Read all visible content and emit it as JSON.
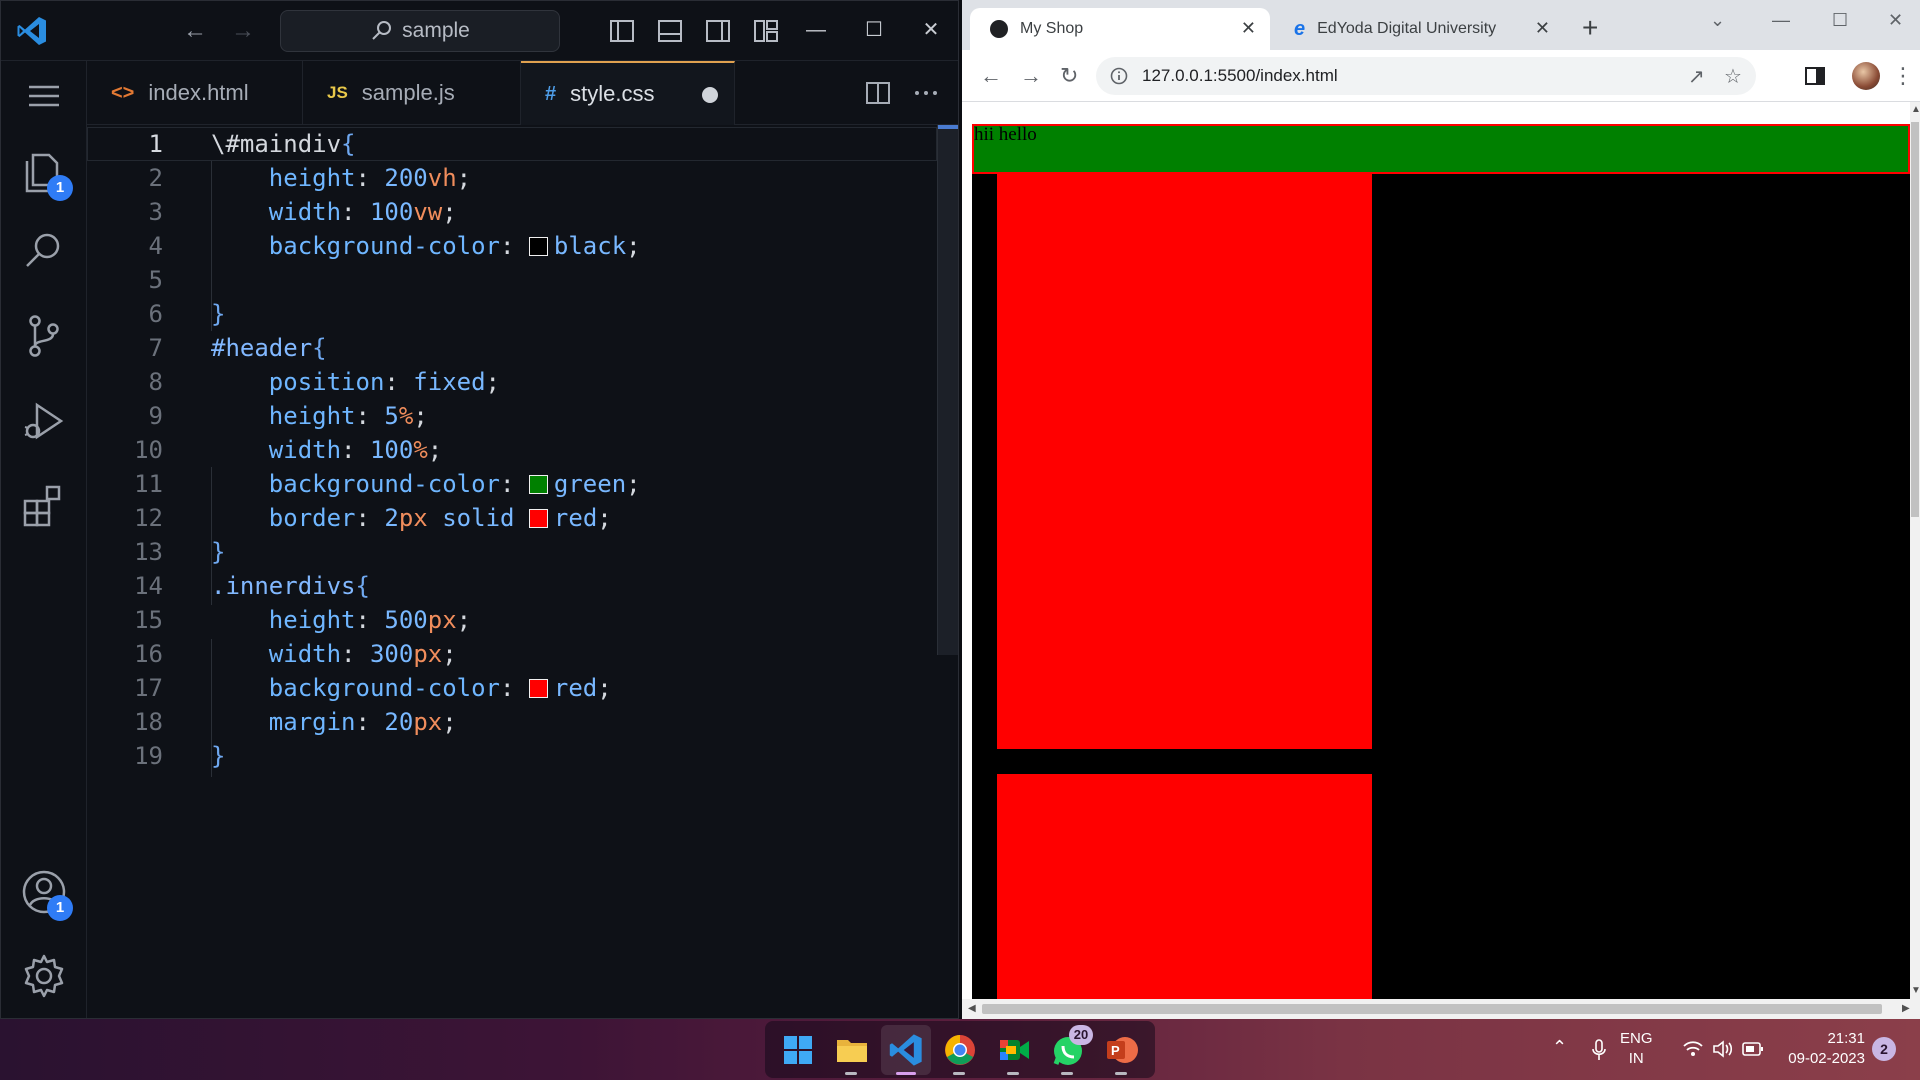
{
  "vscode": {
    "search_text": "sample",
    "tabs": [
      {
        "icon": "<>",
        "label": "index.html",
        "icon_color": "#e37933"
      },
      {
        "icon": "JS",
        "label": "sample.js",
        "icon_color": "#e8c84a"
      },
      {
        "icon": "#",
        "label": "style.css",
        "icon_color": "#4e9de8",
        "modified": true
      }
    ],
    "activity_badges": {
      "explorer": "1",
      "accounts": "1"
    },
    "line_numbers": [
      "1",
      "2",
      "3",
      "4",
      "5",
      "6",
      "7",
      "8",
      "9",
      "10",
      "11",
      "12",
      "13",
      "14",
      "15",
      "16",
      "17",
      "18",
      "19"
    ],
    "code": {
      "l1_sel": "\\#maindiv",
      "l1_brace": "{",
      "l2_prop": "height",
      "l2_num": "200",
      "l2_unit": "vh",
      "l3_prop": "width",
      "l3_num": "100",
      "l3_unit": "vw",
      "l4_prop": "background-color",
      "l4_val": "black",
      "l6": "}",
      "l7_sel": "#header",
      "l7_brace": "{",
      "l8_prop": "position",
      "l8_val": "fixed",
      "l9_prop": "height",
      "l9_num": "5",
      "l9_unit": "%",
      "l10_prop": "width",
      "l10_num": "100",
      "l10_unit": "%",
      "l11_prop": "background-color",
      "l11_val": "green",
      "l12_prop": "border",
      "l12_num": "2",
      "l12_unit": "px",
      "l12_mid": "solid",
      "l12_val": "red",
      "l13": "}",
      "l14_sel": ".innerdivs",
      "l14_brace": "{",
      "l15_prop": "height",
      "l15_num": "500",
      "l15_unit": "px",
      "l16_prop": "width",
      "l16_num": "300",
      "l16_unit": "px",
      "l17_prop": "background-color",
      "l17_val": "red",
      "l18_prop": "margin",
      "l18_num": "20",
      "l18_unit": "px",
      "l19": "}"
    },
    "swatch_colors": {
      "black": "#000000",
      "green": "#008000",
      "red": "#ff0000"
    }
  },
  "chrome": {
    "tabs": [
      {
        "title": "My Shop",
        "active": true
      },
      {
        "title": "EdYoda Digital University",
        "active": false
      }
    ],
    "url": "127.0.0.1:5500/index.html",
    "page": {
      "header_text": "hii hello",
      "colors": {
        "page_bg": "#000000",
        "header_bg": "#008000",
        "header_border": "#ff0000",
        "innerdiv_bg": "#ff0000"
      }
    }
  },
  "taskbar": {
    "whatsapp_badge": "20",
    "language": "ENG",
    "region": "IN",
    "time": "21:31",
    "date": "09-02-2023",
    "notifications": "2"
  }
}
